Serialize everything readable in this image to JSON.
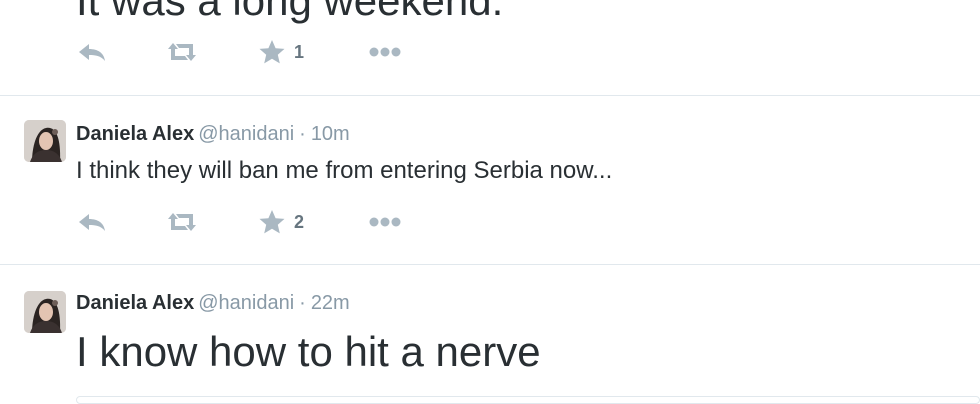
{
  "tweets": [
    {
      "text": "It was a long weekend.",
      "actions": {
        "reply_icon": "reply-icon",
        "retweet_icon": "retweet-icon",
        "favorite_icon": "star-icon",
        "favorite_count": "1",
        "more_icon": "more-dots-icon"
      }
    },
    {
      "author": {
        "fullname": "Daniela Alex",
        "username": "@hanidani",
        "separator": "·",
        "time": "10m"
      },
      "text": "I think they will ban me from entering Serbia now...",
      "actions": {
        "reply_icon": "reply-icon",
        "retweet_icon": "retweet-icon",
        "favorite_icon": "star-icon",
        "favorite_count": "2",
        "more_icon": "more-dots-icon"
      }
    },
    {
      "author": {
        "fullname": "Daniela Alex",
        "username": "@hanidani",
        "separator": "·",
        "time": "22m"
      },
      "text": "I know how to hit a nerve"
    }
  ],
  "colors": {
    "text": "#292f33",
    "muted": "#8899a6",
    "icon": "#aab8c2",
    "divider": "#e1e8ed"
  }
}
